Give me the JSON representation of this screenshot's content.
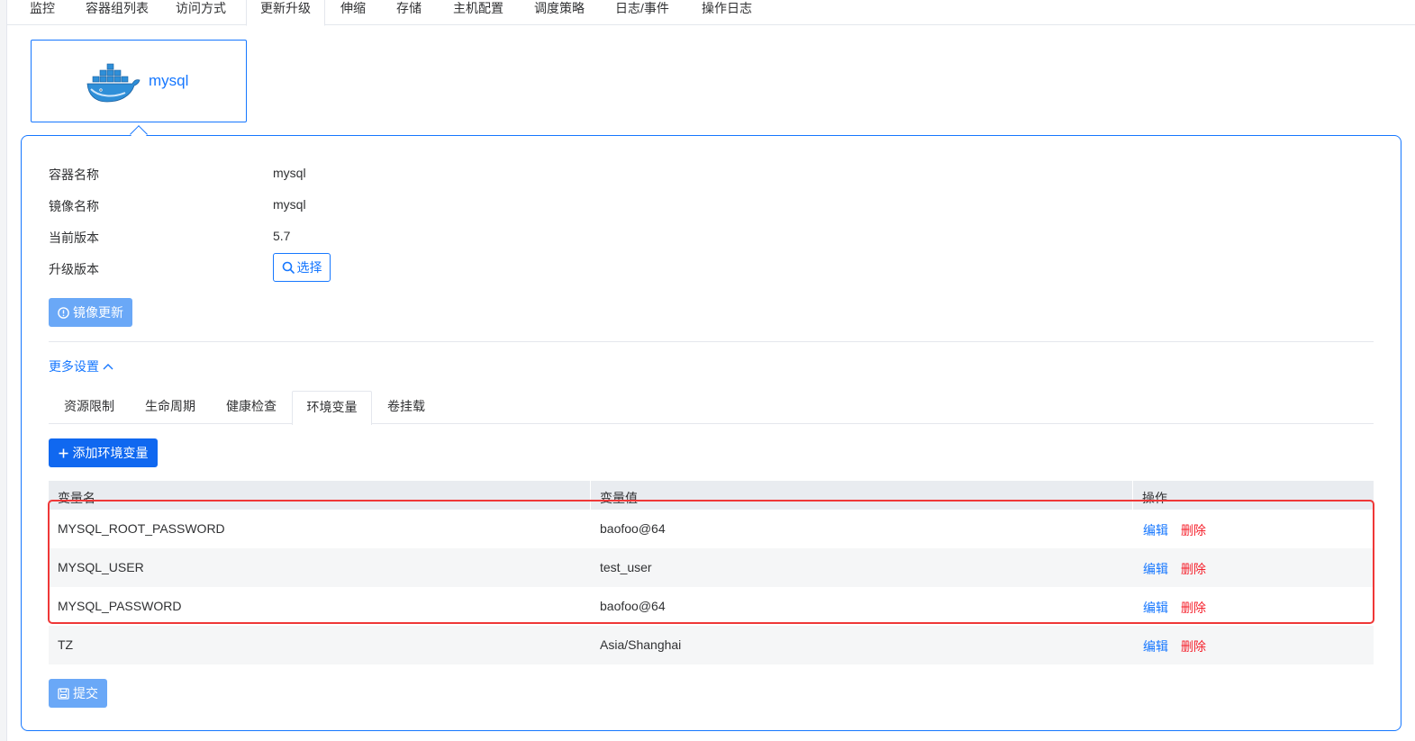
{
  "top_tabs": [
    "监控",
    "容器组列表",
    "访问方式",
    "更新升级",
    "伸缩",
    "存储",
    "主机配置",
    "调度策略",
    "日志/事件",
    "操作日志"
  ],
  "container_card": {
    "name": "mysql"
  },
  "info": {
    "container_name_label": "容器名称",
    "container_name": "mysql",
    "image_name_label": "镜像名称",
    "image_name": "mysql",
    "current_version_label": "当前版本",
    "current_version": "5.7",
    "upgrade_version_label": "升级版本",
    "select_label": "选择"
  },
  "image_update_label": "镜像更新",
  "more_settings_label": "更多设置",
  "sub_tabs": [
    "资源限制",
    "生命周期",
    "健康检查",
    "环境变量",
    "卷挂载"
  ],
  "active_sub_tab": "环境变量",
  "add_env_label": "添加环境变量",
  "table": {
    "headers": [
      "变量名",
      "变量值",
      "操作"
    ],
    "rows": [
      {
        "name": "MYSQL_ROOT_PASSWORD",
        "value": "baofoo@64",
        "edit": "编辑",
        "delete": "删除"
      },
      {
        "name": "MYSQL_USER",
        "value": "test_user",
        "edit": "编辑",
        "delete": "删除"
      },
      {
        "name": "MYSQL_PASSWORD",
        "value": "baofoo@64",
        "edit": "编辑",
        "delete": "删除"
      },
      {
        "name": "TZ",
        "value": "Asia/Shanghai",
        "edit": "编辑",
        "delete": "删除"
      }
    ]
  },
  "submit_label": "提交",
  "colors": {
    "primary": "#1677ff",
    "danger": "#f5222d",
    "highlight": "#ef3737"
  }
}
